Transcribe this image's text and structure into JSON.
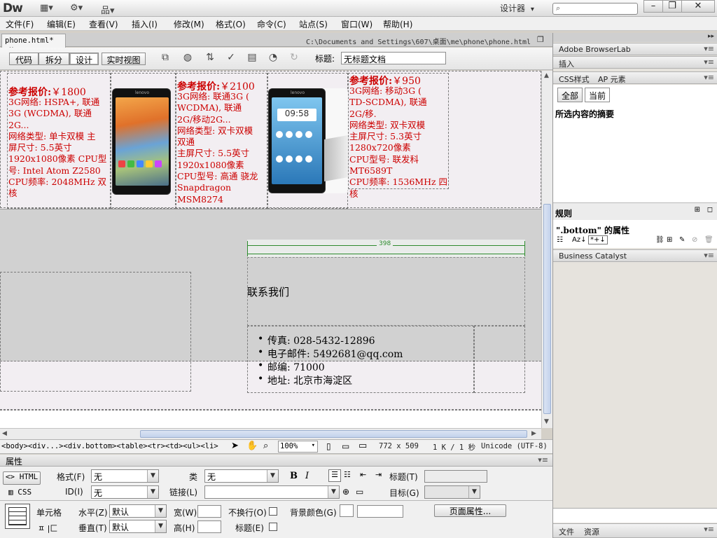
{
  "app": {
    "logo": "Dw",
    "workspace": "设计器",
    "workspace_arrow": "▾",
    "search_icon": "⌕"
  },
  "window_controls": {
    "minimize": "–",
    "restore": "❐",
    "close": "✕"
  },
  "menu": [
    "文件(F)",
    "编辑(E)",
    "查看(V)",
    "插入(I)",
    "修改(M)",
    "格式(O)",
    "命令(C)",
    "站点(S)",
    "窗口(W)",
    "帮助(H)"
  ],
  "document": {
    "tab_label": "phone.html*",
    "tab_close": "×",
    "path": "C:\\Documents and Settings\\607\\桌面\\me\\phone\\phone.html",
    "restore_icon": "❐"
  },
  "toolbar": {
    "views": [
      "代码",
      "拆分",
      "设计",
      "实时视图"
    ],
    "active_view": "设计",
    "title_label": "标题:",
    "title_value": "无标题文档"
  },
  "products": [
    {
      "price_label": "参考报价:",
      "price_value": "￥1800",
      "specs": [
        "3G网络: HSPA+, 联通",
        "3G (WCDMA), 联通",
        "2G...",
        "网络类型: 单卡双模 主",
        "屏尺寸: 5.5英寸",
        "1920x1080像素 CPU型",
        "号: Intel Atom Z2580",
        "CPU频率: 2048MHz 双",
        "核"
      ]
    },
    {
      "price_label": "参考报价:",
      "price_value": "￥2100",
      "specs": [
        "3G网络: 联通3G (",
        "WCDMA), 联通",
        "2G/移动2G...",
        "网络类型: 双卡双模",
        "双通",
        "主屏尺寸: 5.5英寸",
        "1920x1080像素",
        "CPU型号: 高通 骁龙",
        "Snapdragon",
        "MSM8274"
      ]
    },
    {
      "price_label": "参考报价:",
      "price_value": "￥950",
      "specs": [
        "3G网络: 移动3G (",
        "TD-SCDMA), 联通",
        "2G/移.",
        "网络类型: 双卡双模",
        "主屏尺寸: 5.3英寸",
        "1280x720像素",
        "CPU型号: 联发科",
        "MT6589T",
        "CPU频率: 1536MHz 四",
        "核"
      ]
    }
  ],
  "phone_images": {
    "brand": "lenovo",
    "clock": "09:58"
  },
  "footer": {
    "width_ruler": "398",
    "contact_title": "联系我们",
    "contacts": [
      "传真: 028-5432-12896",
      "电子邮件: 5492681@qq.com",
      "邮编: 71000",
      "地址: 北京市海淀区"
    ]
  },
  "status": {
    "tag_path": "<body><div...><div.bottom><table><tr><td><ul><li>",
    "zoom": "100%",
    "dimensions": "772 x 509",
    "size": "1 K / 1 秒",
    "encoding": "Unicode (UTF-8)"
  },
  "properties": {
    "header": "属性",
    "html_btn": "HTML",
    "css_btn": "CSS",
    "format_label": "格式(F)",
    "format_value": "无",
    "class_label": "类",
    "class_value": "无",
    "id_label": "ID(I)",
    "id_value": "无",
    "link_label": "链接(L)",
    "title_label": "标题(T)",
    "target_label": "目标(G)",
    "bold": "B",
    "italic": "I",
    "cell_label": "单元格",
    "horiz_label": "水平(Z)",
    "horiz_value": "默认",
    "vert_label": "垂直(T)",
    "vert_value": "默认",
    "width_label": "宽(W)",
    "height_label": "高(H)",
    "nowrap_label": "不换行(O)",
    "header_label": "标题(E)",
    "bgcolor_label": "背景颜色(G)",
    "page_props_btn": "页面属性...",
    "jc": "ㅍ |匚"
  },
  "right_panels": {
    "browserlab": "Adobe BrowserLab",
    "insert": "插入",
    "css_tab": "CSS样式",
    "ap_tab": "AP 元素",
    "all_btn": "全部",
    "current_btn": "当前",
    "summary": "所选内容的摘要",
    "rules": "规则",
    "properties_of": "\".bottom\" 的属性",
    "business_catalyst": "Business Catalyst",
    "files_tab": "文件",
    "assets_tab": "资源"
  }
}
